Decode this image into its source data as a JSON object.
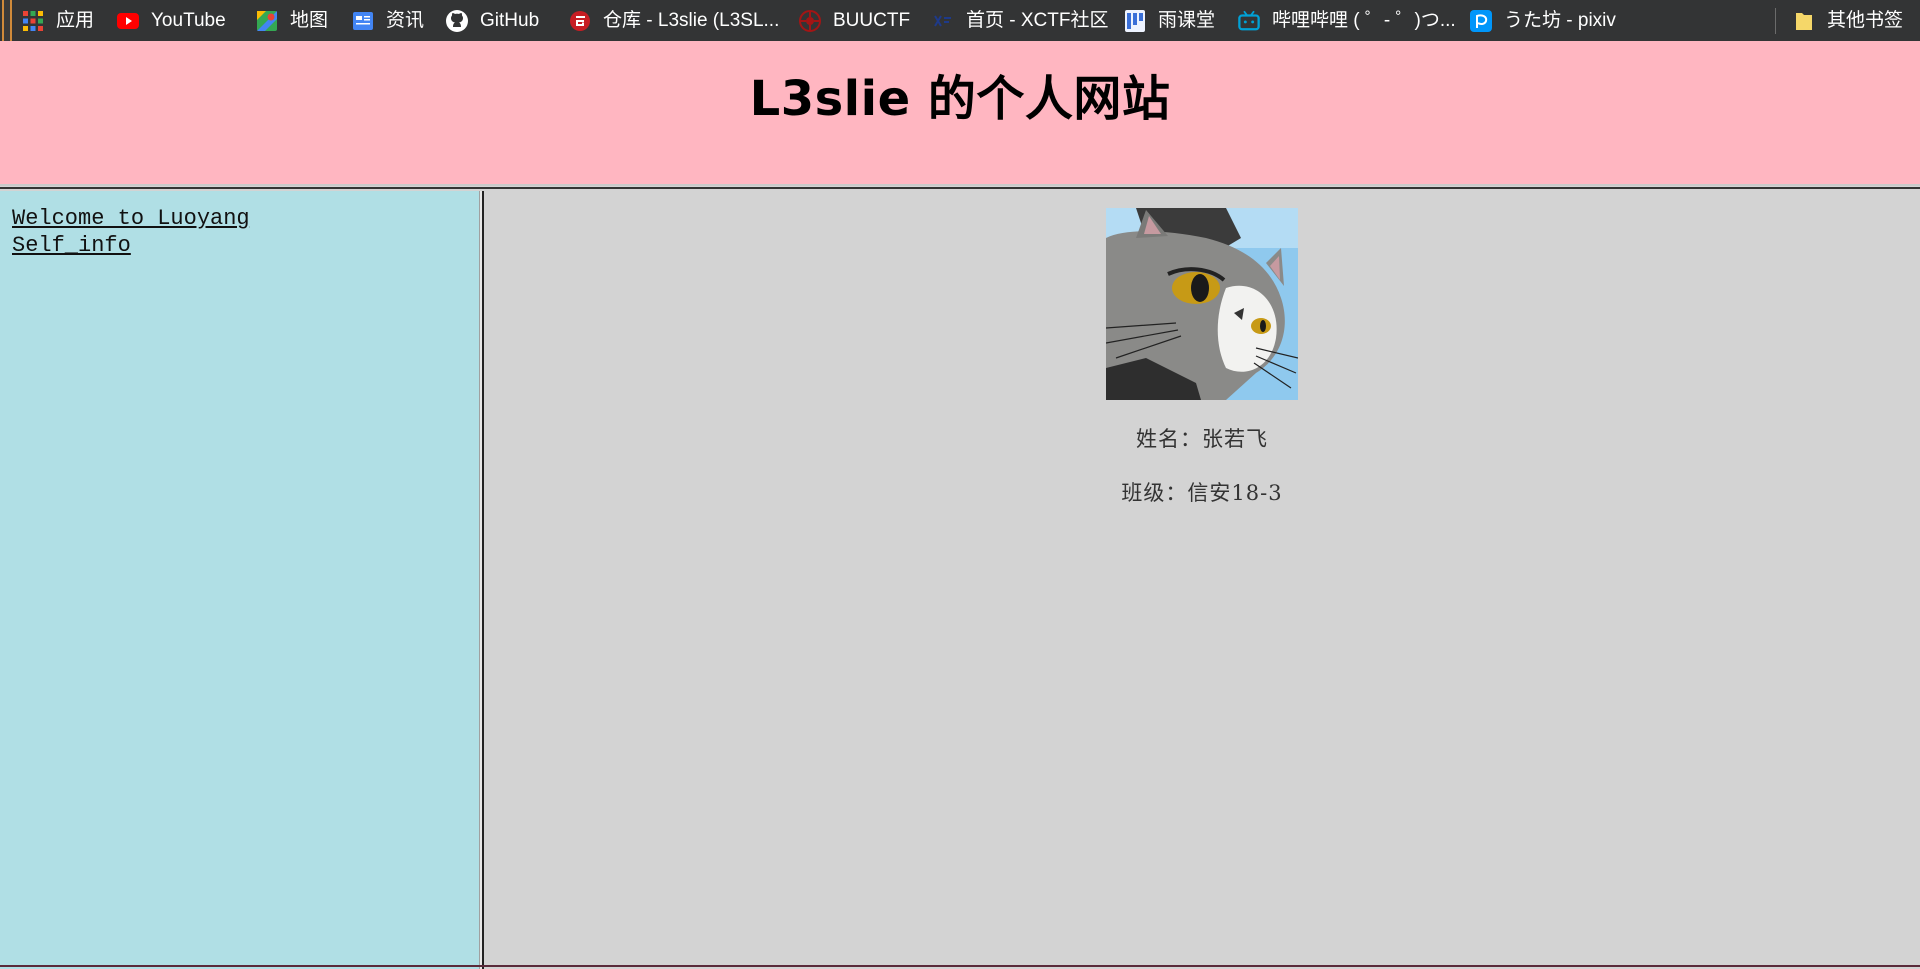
{
  "bookmarks": [
    {
      "label": "应用",
      "icon": "apps-grid-icon"
    },
    {
      "label": "YouTube",
      "icon": "youtube-icon"
    },
    {
      "label": "地图",
      "icon": "maps-icon"
    },
    {
      "label": "资讯",
      "icon": "news-icon"
    },
    {
      "label": "GitHub",
      "icon": "github-icon"
    },
    {
      "label": "仓库 - L3slie (L3SL...",
      "icon": "gitee-icon"
    },
    {
      "label": "BUUCTF",
      "icon": "buuctf-icon"
    },
    {
      "label": "首页 - XCTF社区",
      "icon": "xctf-icon"
    },
    {
      "label": "雨课堂",
      "icon": "yuketang-icon"
    },
    {
      "label": "哔哩哔哩 ( ゜- ゜)つ...",
      "icon": "bilibili-icon"
    },
    {
      "label": "うた坊 - pixiv",
      "icon": "pixiv-icon"
    }
  ],
  "other_bookmarks": {
    "label": "其他书签",
    "icon": "folder-icon"
  },
  "header": {
    "title": "L3slie 的个人网站"
  },
  "nav": {
    "links": [
      "Welcome to Luoyang",
      "Self_info"
    ]
  },
  "profile": {
    "name_line": "姓名：张若飞",
    "class_line": "班级：信安18-3",
    "avatar": "cat-avatar-image"
  },
  "colors": {
    "bookmarks_bg": "#333435",
    "header_bg": "#ffb6c1",
    "left_frame_bg": "#b0dfe5",
    "right_frame_bg": "#d3d3d3"
  }
}
